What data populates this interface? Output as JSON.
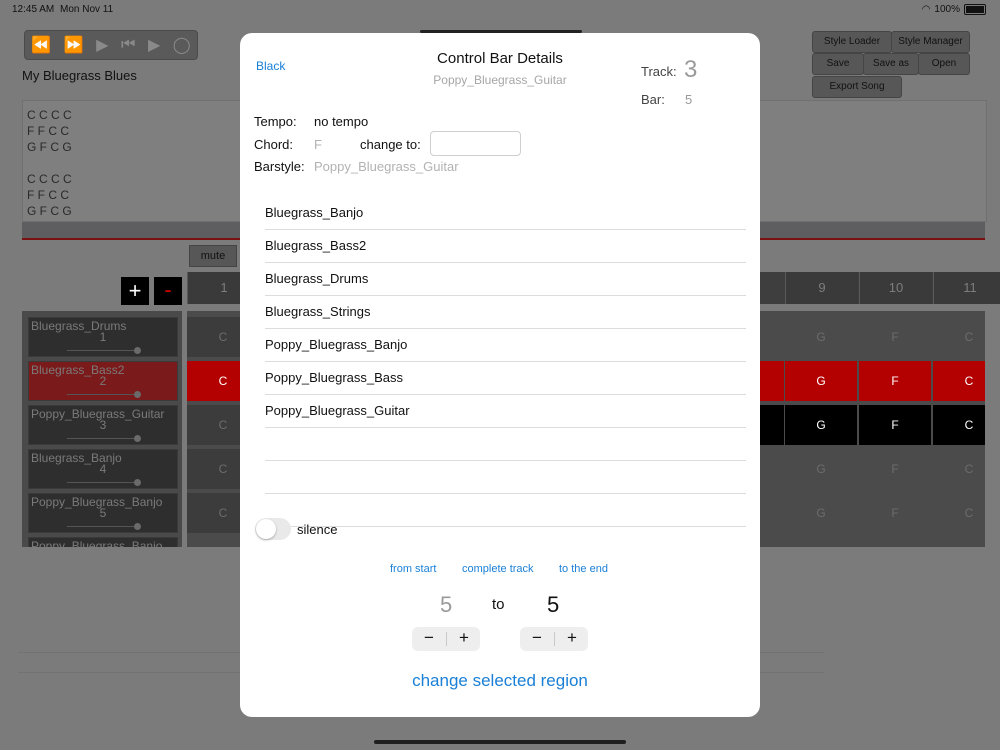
{
  "status": {
    "time": "12:45 AM",
    "date": "Mon Nov 11",
    "battery": "100%"
  },
  "app": {
    "song_title": "My Bluegrass Blues",
    "chord_text": "C C C C\nF F C C\nG F C G\n\nC C C C\nF F C C\nG F C G",
    "buttons": {
      "style_loader": "Style Loader",
      "style_manager": "Style Manager",
      "save": "Save",
      "save_as": "Save as",
      "open": "Open",
      "export_song": "Export Song"
    },
    "mute": "mute",
    "plus": "+",
    "minus": "-",
    "tracks": [
      {
        "name": "Bluegrass_Drums",
        "num": "1"
      },
      {
        "name": "Bluegrass_Bass2",
        "num": "2"
      },
      {
        "name": "Poppy_Bluegrass_Guitar",
        "num": "3"
      },
      {
        "name": "Bluegrass_Banjo",
        "num": "4"
      },
      {
        "name": "Poppy_Bluegrass_Banjo",
        "num": "5"
      },
      {
        "name": "Poppy_Bluegrass_Banjo",
        "num": ""
      }
    ],
    "bar_headers": [
      "1",
      "9",
      "10",
      "11"
    ],
    "grid_rows": [
      {
        "first": "C",
        "cells": [
          "G",
          "F",
          "C"
        ]
      },
      {
        "first": "C",
        "cells": [
          "G",
          "F",
          "C"
        ]
      },
      {
        "first": "C",
        "cells": [
          "G",
          "F",
          "C"
        ]
      },
      {
        "first": "C",
        "cells": [
          "G",
          "F",
          "C"
        ]
      },
      {
        "first": "C",
        "cells": [
          "G",
          "F",
          "C"
        ]
      }
    ],
    "first_col_labels": [
      "Bluegrass_D",
      "Bluegrass_B",
      "Poppy_Bluegr",
      "Bluegrass_B",
      "Poppy_Bluegr"
    ]
  },
  "modal": {
    "back": "Black",
    "title": "Control Bar Details",
    "subtitle": "Poppy_Bluegrass_Guitar",
    "track_label": "Track:",
    "track_value": "3",
    "bar_label": "Bar:",
    "bar_value": "5",
    "tempo_label": "Tempo:",
    "tempo_value": "no tempo",
    "chord_label": "Chord:",
    "chord_value": "F",
    "change_to_label": "change to:",
    "change_to_value": "",
    "barstyle_label": "Barstyle:",
    "barstyle_value": "Poppy_Bluegrass_Guitar",
    "styles": [
      "Bluegrass_Banjo",
      "Bluegrass_Bass2",
      "Bluegrass_Drums",
      "Bluegrass_Strings",
      "Poppy_Bluegrass_Banjo",
      "Poppy_Bluegrass_Bass",
      "Poppy_Bluegrass_Guitar",
      "",
      "",
      ""
    ],
    "silence_label": "silence",
    "silence_on": false,
    "from_start": "from start",
    "complete_track": "complete track",
    "to_the_end": "to the end",
    "range_from": "5",
    "range_to_word": "to",
    "range_to": "5",
    "minus": "−",
    "plus": "+",
    "change_region": "change selected region"
  }
}
